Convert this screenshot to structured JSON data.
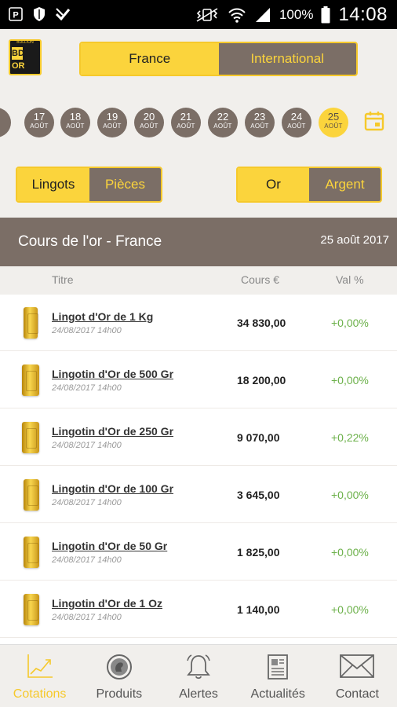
{
  "status_bar": {
    "battery": "100%",
    "time": "14:08",
    "left_icons": [
      "p-icon",
      "shield-icon",
      "check-icon"
    ],
    "right_icons": [
      "vibrate-icon",
      "wifi-icon",
      "signal-icon",
      "battery-icon"
    ]
  },
  "header": {
    "logo_text": [
      "BD",
      "OR"
    ],
    "tabs": [
      {
        "label": "France",
        "active": true
      },
      {
        "label": "International",
        "active": false
      }
    ]
  },
  "dates": [
    {
      "day": "",
      "month": "",
      "partial": true
    },
    {
      "day": "17",
      "month": "AOÛT"
    },
    {
      "day": "18",
      "month": "AOÛT"
    },
    {
      "day": "19",
      "month": "AOÛT"
    },
    {
      "day": "20",
      "month": "AOÛT"
    },
    {
      "day": "21",
      "month": "AOÛT"
    },
    {
      "day": "22",
      "month": "AOÛT"
    },
    {
      "day": "23",
      "month": "AOÛT"
    },
    {
      "day": "24",
      "month": "AOÛT"
    },
    {
      "day": "25",
      "month": "AOÛT",
      "selected": true
    }
  ],
  "filters": {
    "type": [
      {
        "label": "Lingots",
        "active": true
      },
      {
        "label": "Pièces",
        "active": false
      }
    ],
    "metal": [
      {
        "label": "Or",
        "active": true
      },
      {
        "label": "Argent",
        "active": false
      }
    ]
  },
  "title_bar": {
    "title": "Cours de l'or - France",
    "date": "25 août 2017"
  },
  "columns": {
    "titre": "Titre",
    "cours": "Cours €",
    "val": "Val %"
  },
  "rows": [
    {
      "name": "Lingot d'Or de 1 Kg",
      "date": "24/08/2017 14h00",
      "price": "34 830,00",
      "var": "+0,00%"
    },
    {
      "name": "Lingotin d'Or de 500 Gr",
      "date": "24/08/2017 14h00",
      "price": "18 200,00",
      "var": "+0,00%"
    },
    {
      "name": "Lingotin d'Or de 250 Gr",
      "date": "24/08/2017 14h00",
      "price": "9 070,00",
      "var": "+0,22%"
    },
    {
      "name": "Lingotin d'Or de 100 Gr",
      "date": "24/08/2017 14h00",
      "price": "3 645,00",
      "var": "+0,00%"
    },
    {
      "name": "Lingotin d'Or de 50 Gr",
      "date": "24/08/2017 14h00",
      "price": "1 825,00",
      "var": "+0,00%"
    },
    {
      "name": "Lingotin d'Or de 1 Oz",
      "date": "24/08/2017 14h00",
      "price": "1 140,00",
      "var": "+0,00%"
    }
  ],
  "nav": [
    {
      "label": "Cotations",
      "icon": "chart-icon",
      "active": true
    },
    {
      "label": "Produits",
      "icon": "coin-icon",
      "active": false
    },
    {
      "label": "Alertes",
      "icon": "bell-icon",
      "active": false
    },
    {
      "label": "Actualités",
      "icon": "newspaper-icon",
      "active": false
    },
    {
      "label": "Contact",
      "icon": "envelope-icon",
      "active": false
    }
  ],
  "colors": {
    "accent": "#fbd43c",
    "brown": "#7b6e66",
    "positive": "#6cb14a",
    "background": "#f1efec"
  }
}
